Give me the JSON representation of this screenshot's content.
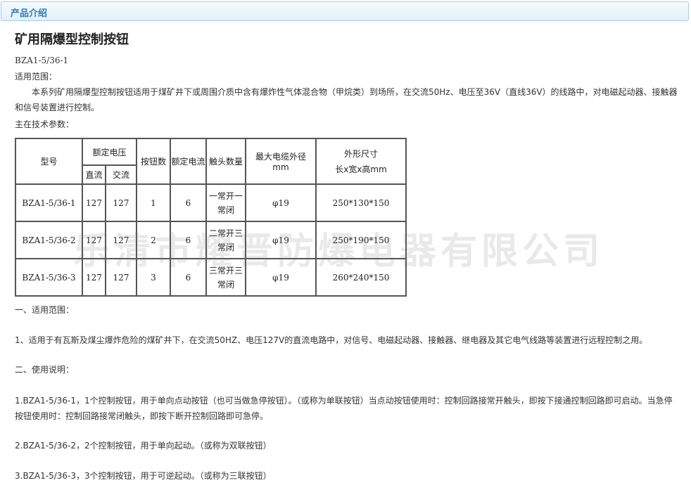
{
  "header": {
    "title": "产品介绍"
  },
  "product": {
    "title": "矿用隔爆型控制按钮",
    "model": "BZA1-5/36-1",
    "scope_label": "适用范围：",
    "scope_text": "本系列矿用隔爆型控制按钮适用于煤矿井下或周围介质中含有爆炸性气体混合物（甲烷类）到场所，在交流50Hz、电压至36V（直线36V）的线路中，对电磁起动器、接触器和信号装置进行控制。",
    "params_label": "主在技术参数："
  },
  "table": {
    "headers": {
      "model": "型号",
      "voltage": "额定电压",
      "dc": "直流",
      "ac": "交流",
      "buttons": "按钮数",
      "current": "额定电流",
      "contacts": "触头数量",
      "cable": "最大电缆外径 mm",
      "size_line1": "外形尺寸",
      "size_line2": "长x宽x高mm"
    },
    "rows": [
      {
        "model": "BZA1-5/36-1",
        "dc": "127",
        "ac": "127",
        "buttons": "1",
        "current": "6",
        "contacts_1": "一常开一",
        "contacts_2": "常闭",
        "cable": "φ19",
        "size": "250*130*150"
      },
      {
        "model": "BZA1-5/36-2",
        "dc": "127",
        "ac": "127",
        "buttons": "2",
        "current": "6",
        "contacts_1": "二常开三",
        "contacts_2": "常闭",
        "cable": "φ19",
        "size": "250*190*150"
      },
      {
        "model": "BZA1-5/36-3",
        "dc": "127",
        "ac": "127",
        "buttons": "3",
        "current": "6",
        "contacts_1": "三常开三",
        "contacts_2": "常闭",
        "cable": "φ19",
        "size": "260*240*150"
      }
    ]
  },
  "watermark": "乐清市耀晋防爆电器有限公司",
  "sections": {
    "s1_title": "一、适用范围：",
    "s1_text": "1、适用于有瓦斯及煤尘爆炸危险的煤矿井下，在交流50HZ、电压127V的直流电路中，对信号、电磁起动器、接触器、继电器及其它电气线路等装置进行远程控制之用。",
    "s2_title": "二、使用说明：",
    "s2_item1": "1.BZA1-5/36-1，1个控制按钮，用于单向点动按钮（也可当做急停按钮）。（或称为单联按钮）当点动按钮使用时：控制回路接常开触头，即按下接通控制回路即可启动。当急停按钮使用时：控制回路接常闭触头，即按下断开控制回路即可急停。",
    "s2_item2": "2.BZA1-5/36-2，2个控制按钮，用于单向起动。（或称为双联按钮）",
    "s2_item3": "3.BZA1-5/36-3，3个控制按钮，用于可逆起动。（或称为三联按钮）"
  }
}
